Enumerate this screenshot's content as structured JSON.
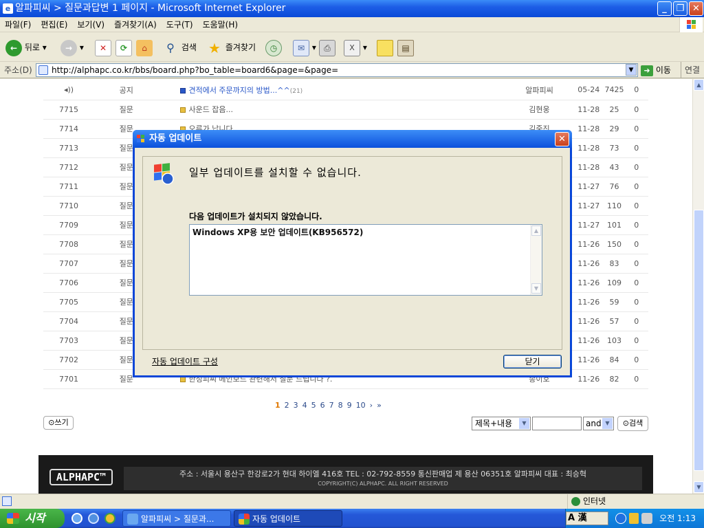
{
  "window": {
    "title": "알파피씨 > 질문과답변 1 페이지 - Microsoft Internet Explorer"
  },
  "menu": [
    "파일(F)",
    "편집(E)",
    "보기(V)",
    "즐겨찾기(A)",
    "도구(T)",
    "도움말(H)"
  ],
  "toolbar": {
    "back": "뒤로",
    "search": "검색",
    "favorites": "즐겨찾기"
  },
  "address": {
    "label": "주소(D)",
    "url": "http://alphapc.co.kr/bbs/board.php?bo_table=board6&page=&page=",
    "go": "이동",
    "links": "연결"
  },
  "board": {
    "notice": {
      "cat": "공지",
      "title": "견적에서 주문까지의 방법...^^",
      "comments": "(21)",
      "name": "알파피씨",
      "date": "05-24",
      "hits": "7425",
      "rec": "0"
    },
    "rows": [
      {
        "num": "7715",
        "cat": "질문",
        "title": "사운드 잡음...",
        "name": "김현웅",
        "date": "11-28",
        "hits": "25",
        "rec": "0"
      },
      {
        "num": "7714",
        "cat": "질문",
        "title": "오류가 납니다",
        "name": "김중진",
        "date": "11-28",
        "hits": "29",
        "rec": "0"
      },
      {
        "num": "7713",
        "cat": "질문",
        "title": "",
        "name": "",
        "date": "11-28",
        "hits": "73",
        "rec": "0"
      },
      {
        "num": "7712",
        "cat": "질문",
        "title": "",
        "name": "",
        "date": "11-28",
        "hits": "43",
        "rec": "0"
      },
      {
        "num": "7711",
        "cat": "질문",
        "title": "",
        "name": "",
        "date": "11-27",
        "hits": "76",
        "rec": "0"
      },
      {
        "num": "7710",
        "cat": "질문",
        "title": "",
        "name": "",
        "date": "11-27",
        "hits": "110",
        "rec": "0"
      },
      {
        "num": "7709",
        "cat": "질문",
        "title": "",
        "name": "",
        "date": "11-27",
        "hits": "101",
        "rec": "0"
      },
      {
        "num": "7708",
        "cat": "질문",
        "title": "",
        "name": "",
        "date": "11-26",
        "hits": "150",
        "rec": "0"
      },
      {
        "num": "7707",
        "cat": "질문",
        "title": "",
        "name": "",
        "date": "11-26",
        "hits": "83",
        "rec": "0"
      },
      {
        "num": "7706",
        "cat": "질문",
        "title": "",
        "name": "",
        "date": "11-26",
        "hits": "109",
        "rec": "0"
      },
      {
        "num": "7705",
        "cat": "질문",
        "title": "",
        "name": "",
        "date": "11-26",
        "hits": "59",
        "rec": "0"
      },
      {
        "num": "7704",
        "cat": "질문",
        "title": "",
        "name": "",
        "date": "11-26",
        "hits": "57",
        "rec": "0"
      },
      {
        "num": "7703",
        "cat": "질문",
        "title": "",
        "name": "",
        "date": "11-26",
        "hits": "103",
        "rec": "0"
      },
      {
        "num": "7702",
        "cat": "질문",
        "title": "",
        "name": "",
        "date": "11-26",
        "hits": "84",
        "rec": "0"
      },
      {
        "num": "7701",
        "cat": "질문",
        "title": "한성피씨 메인보드 관련해서 질문 드립니다 ?.",
        "name": "송이호",
        "date": "11-26",
        "hits": "82",
        "rec": "0"
      }
    ]
  },
  "pager": {
    "pages": [
      "1",
      "2",
      "3",
      "4",
      "5",
      "6",
      "7",
      "8",
      "9",
      "10"
    ],
    "current": "1",
    "next": "›",
    "last": "»"
  },
  "write_label": "쓰기",
  "search": {
    "field": "제목+내용",
    "value": "",
    "op": "and",
    "button": "검색"
  },
  "footer": {
    "logo": "ALPHAPC™",
    "address": "주소 : 서울시 용산구 한강로2가 현대 하이엘 416호   TEL : 02-792-8559   통신판매업 제 용산 06351호 알파피씨 대표 : 최승혁",
    "copyright": "COPYRIGHT(C) ALPHAPC. ALL RIGHT RESERVED"
  },
  "status": {
    "zone": "인터넷"
  },
  "dialog": {
    "title": "자동 업데이트",
    "heading": "일부 업데이트를 설치할 수 없습니다.",
    "subheading": "다음 업데이트가 설치되지 않았습니다.",
    "items": [
      "Windows XP용 보안 업데이트(KB956572)"
    ],
    "config_link": "자동 업데이트 구성",
    "close_button": "닫기"
  },
  "taskbar": {
    "start": "시작",
    "tasks": [
      "알파피씨 > 질문과...",
      "자동 업데이트"
    ],
    "ime": "A 漢",
    "clock": "오전 1:13"
  }
}
